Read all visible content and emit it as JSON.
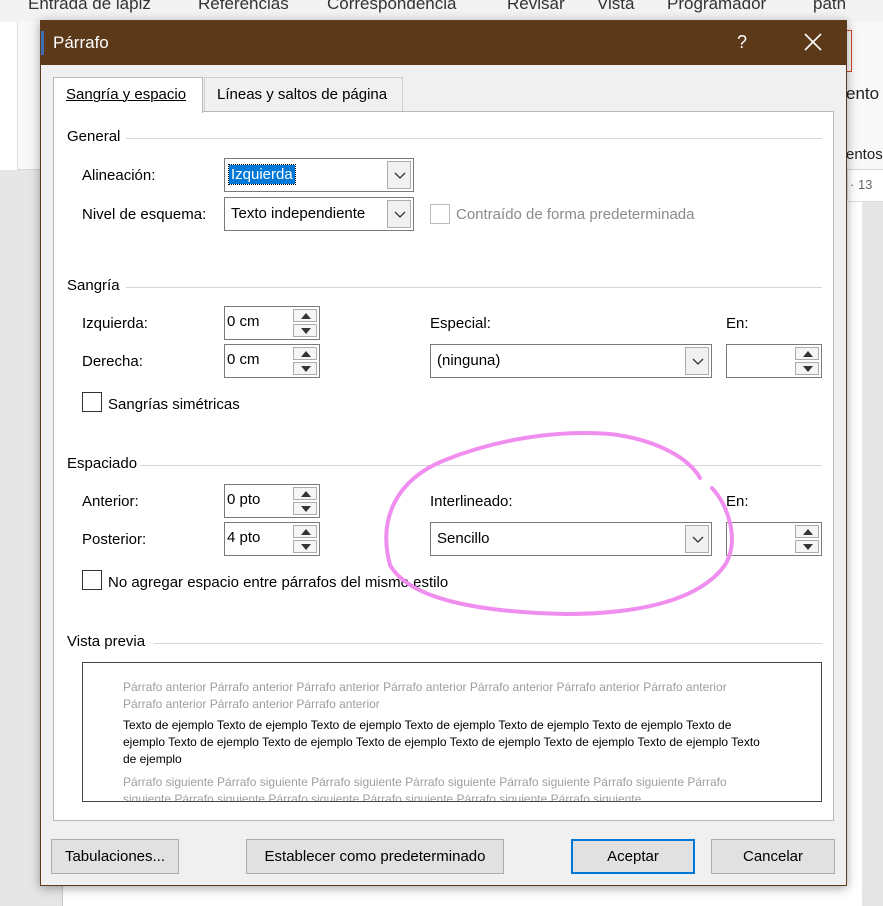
{
  "background": {
    "ribbon_tabs": [
      "Entrada de lápiz",
      "Referencias",
      "Correspondencia",
      "Revisar",
      "Vista",
      "Programador",
      "path"
    ],
    "right_text_1": "ento",
    "right_text_2": "entos",
    "ruler_text": "· 13"
  },
  "dialog": {
    "title": "Párrafo",
    "help_label": "?",
    "tabs": [
      {
        "label": "Sangría y espacio",
        "active": true
      },
      {
        "label": "Líneas y saltos de página",
        "active": false
      }
    ]
  },
  "general": {
    "heading": "General",
    "alignment_label": "Alineación:",
    "alignment_value": "Izquierda",
    "outline_label": "Nivel de esquema:",
    "outline_value": "Texto independiente",
    "collapsed_label": "Contraído de forma predeterminada"
  },
  "indent": {
    "heading": "Sangría",
    "left_label": "Izquierda:",
    "left_value": "0 cm",
    "right_label": "Derecha:",
    "right_value": "0 cm",
    "special_label": "Especial:",
    "special_value": "(ninguna)",
    "by_label": "En:",
    "by_value": "",
    "mirror_label": "Sangrías simétricas"
  },
  "spacing": {
    "heading": "Espaciado",
    "before_label": "Anterior:",
    "before_value": "0 pto",
    "after_label": "Posterior:",
    "after_value": "4 pto",
    "line_label": "Interlineado:",
    "line_value": "Sencillo",
    "at_label": "En:",
    "at_value": "",
    "no_space_label": "No agregar espacio entre párrafos del mismo estilo"
  },
  "preview": {
    "heading": "Vista previa",
    "previous_text": "Párrafo anterior Párrafo anterior Párrafo anterior Párrafo anterior Párrafo anterior Párrafo anterior Párrafo anterior Párrafo anterior Párrafo anterior Párrafo anterior",
    "sample_text": "Texto de ejemplo Texto de ejemplo Texto de ejemplo Texto de ejemplo Texto de ejemplo Texto de ejemplo Texto de ejemplo Texto de ejemplo Texto de ejemplo Texto de ejemplo Texto de ejemplo Texto de ejemplo Texto de ejemplo Texto de ejemplo",
    "next_text": "Párrafo siguiente Párrafo siguiente Párrafo siguiente Párrafo siguiente Párrafo siguiente Párrafo siguiente Párrafo siguiente Párrafo siguiente Párrafo siguiente Párrafo siguiente Párrafo siguiente Párrafo siguiente"
  },
  "buttons": {
    "tabs_label": "Tabulaciones...",
    "default_label": "Establecer como predeterminado",
    "ok_label": "Aceptar",
    "cancel_label": "Cancelar"
  },
  "colors": {
    "titlebar": "#5c3918",
    "selection": "#0078d7",
    "highlight_stroke": "#f08ef0"
  }
}
